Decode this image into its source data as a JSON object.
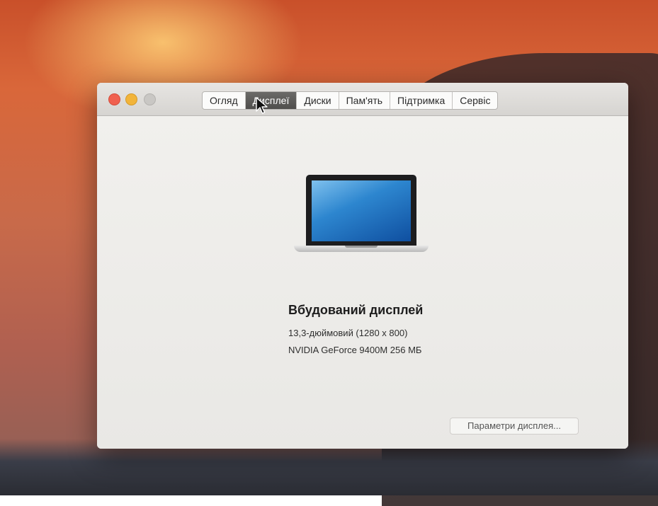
{
  "window": {
    "tabs": [
      {
        "label": "Огляд"
      },
      {
        "label": "Дисплеї"
      },
      {
        "label": "Диски"
      },
      {
        "label": "Пам'ять"
      },
      {
        "label": "Підтримка"
      },
      {
        "label": "Сервіс"
      }
    ],
    "active_tab": "Дисплеї"
  },
  "display": {
    "name": "Вбудований дисплей",
    "size": "13,3-дюймовий (1280 x 800)",
    "gpu": "NVIDIA GeForce 9400M 256 МБ"
  },
  "buttons": {
    "display_settings": "Параметри дисплея..."
  },
  "icons": {
    "close": "close-icon",
    "minimize": "minimize-icon",
    "zoom": "zoom-icon",
    "laptop": "laptop-icon",
    "cursor": "cursor-icon"
  },
  "colors": {
    "active_tab_bg": "#4f4e4c",
    "close": "#f0604f",
    "minimize": "#f2b43a",
    "zoom": "#c9c7c4"
  }
}
